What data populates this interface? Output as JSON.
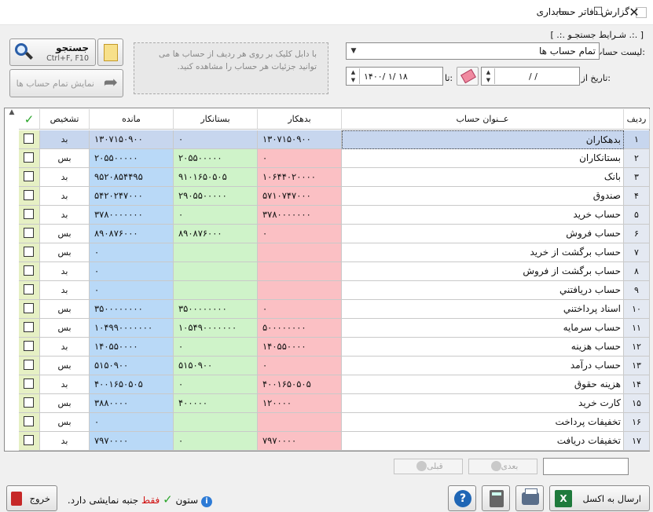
{
  "window": {
    "title": "گزارش دفاتر حسابداری",
    "min_glyph": "—",
    "max_glyph": "☐",
    "close_glyph": "✕"
  },
  "search_group": {
    "legend": "[ .:. شـرایط جستجـو .:. ]",
    "account_list_label": "لیست حساب ها:",
    "account_list_value": "تمام حساب ها",
    "date_label": "تاریخ از:",
    "to_label": "تا:",
    "date_from": "/    /",
    "date_to": "۱۴۰۰/ ۱/ ۱۸",
    "hint": "با دابل کلیک بر روی هر ردیف از حساب ها می توانید جزئیات هر حساب را مشاهده کنید.",
    "search_label": "جستجو",
    "search_shortcut": "Ctrl+F, F10",
    "show_all_label": "نمایش تمام حساب ها"
  },
  "table": {
    "columns": {
      "index": "ردیف",
      "title": "عــنوان حساب",
      "debit": "بدهکار",
      "credit": "بستانکار",
      "balance": "مانده",
      "diagnosis": "تشخیص",
      "check": "✓"
    },
    "rows": [
      {
        "i": "۱",
        "title": "بدهکاران",
        "debit": "۱۳۰۷۱۵۰۹۰۰",
        "credit": "۰",
        "balance": "۱۳۰۷۱۵۰۹۰۰",
        "diag": "بد"
      },
      {
        "i": "۲",
        "title": "بستانکاران",
        "debit": "۰",
        "credit": "۲۰۵۵۰۰۰۰۰",
        "balance": "۲۰۵۵۰۰۰۰۰",
        "diag": "بس"
      },
      {
        "i": "۳",
        "title": "بانک",
        "debit": "۱۰۶۴۴۰۲۰۰۰۰",
        "credit": "۹۱۰۱۶۵۰۵۰۵",
        "balance": "۹۵۲۰۸۵۴۴۹۵",
        "diag": "بد"
      },
      {
        "i": "۴",
        "title": "صندوق",
        "debit": "۵۷۱۰۷۴۷۰۰۰",
        "credit": "۲۹۰۵۵۰۰۰۰۰",
        "balance": "۵۴۲۰۲۴۷۰۰۰",
        "diag": "بد"
      },
      {
        "i": "۵",
        "title": "حساب خرید",
        "debit": "۳۷۸۰۰۰۰۰۰۰",
        "credit": "۰",
        "balance": "۳۷۸۰۰۰۰۰۰۰",
        "diag": "بد"
      },
      {
        "i": "۶",
        "title": "حساب فروش",
        "debit": "۰",
        "credit": "۸۹۰۸۷۶۰۰۰",
        "balance": "۸۹۰۸۷۶۰۰۰",
        "diag": "بس"
      },
      {
        "i": "۷",
        "title": "حساب برگشت از خرید",
        "debit": "",
        "credit": "",
        "balance": "۰",
        "diag": "بس"
      },
      {
        "i": "۸",
        "title": "حساب برگشت از فروش",
        "debit": "",
        "credit": "",
        "balance": "۰",
        "diag": "بد"
      },
      {
        "i": "۹",
        "title": "حساب دريافتني",
        "debit": "",
        "credit": "",
        "balance": "۰",
        "diag": "بد"
      },
      {
        "i": "۱۰",
        "title": "اسناد پرداختني",
        "debit": "۰",
        "credit": "۳۵۰۰۰۰۰۰۰۰",
        "balance": "۳۵۰۰۰۰۰۰۰۰",
        "diag": "بس"
      },
      {
        "i": "۱۱",
        "title": "حساب سرمايه",
        "debit": "۵۰۰۰۰۰۰۰۰",
        "credit": "۱۰۵۴۹۰۰۰۰۰۰۰",
        "balance": "۱۰۴۹۹۰۰۰۰۰۰۰",
        "diag": "بس"
      },
      {
        "i": "۱۲",
        "title": "حساب هزينه",
        "debit": "۱۴۰۵۵۰۰۰۰",
        "credit": "۰",
        "balance": "۱۴۰۵۵۰۰۰۰",
        "diag": "بد"
      },
      {
        "i": "۱۳",
        "title": "حساب درآمد",
        "debit": "۰",
        "credit": "۵۱۵۰۹۰۰",
        "balance": "۵۱۵۰۹۰۰",
        "diag": "بس"
      },
      {
        "i": "۱۴",
        "title": "هزينه حقوق",
        "debit": "۴۰۰۱۶۵۰۵۰۵",
        "credit": "۰",
        "balance": "۴۰۰۱۶۵۰۵۰۵",
        "diag": "بد"
      },
      {
        "i": "۱۵",
        "title": "کارت خريد",
        "debit": "۱۲۰۰۰۰",
        "credit": "۴۰۰۰۰۰",
        "balance": "۳۸۸۰۰۰۰",
        "diag": "بس"
      },
      {
        "i": "۱۶",
        "title": "تخفيفات پرداخت",
        "debit": "",
        "credit": "",
        "balance": "۰",
        "diag": "بس"
      },
      {
        "i": "۱۷",
        "title": "تخفيفات دريافت",
        "debit": "۷۹۷۰۰۰۰",
        "credit": "۰",
        "balance": "۷۹۷۰۰۰۰",
        "diag": "بد"
      }
    ]
  },
  "pager": {
    "next_label": "بعدی",
    "prev_label": "قبلی",
    "page_value": ""
  },
  "footer": {
    "excel_label": "ارسال به اکسل",
    "excel_icon_text": "X",
    "help_text": "?",
    "exit_label": "خروج",
    "note_column": "ستون",
    "note_only": "فقط",
    "note_rest": "جنبه نمایشی دارد.",
    "info_text": "i"
  },
  "colors": {
    "balance_col": "#b9d9f7",
    "credit_col": "#cff3c9",
    "debit_col": "#fbc0c4",
    "check_col": "#e6f0c4",
    "selected_row": "#c7d6ee"
  }
}
